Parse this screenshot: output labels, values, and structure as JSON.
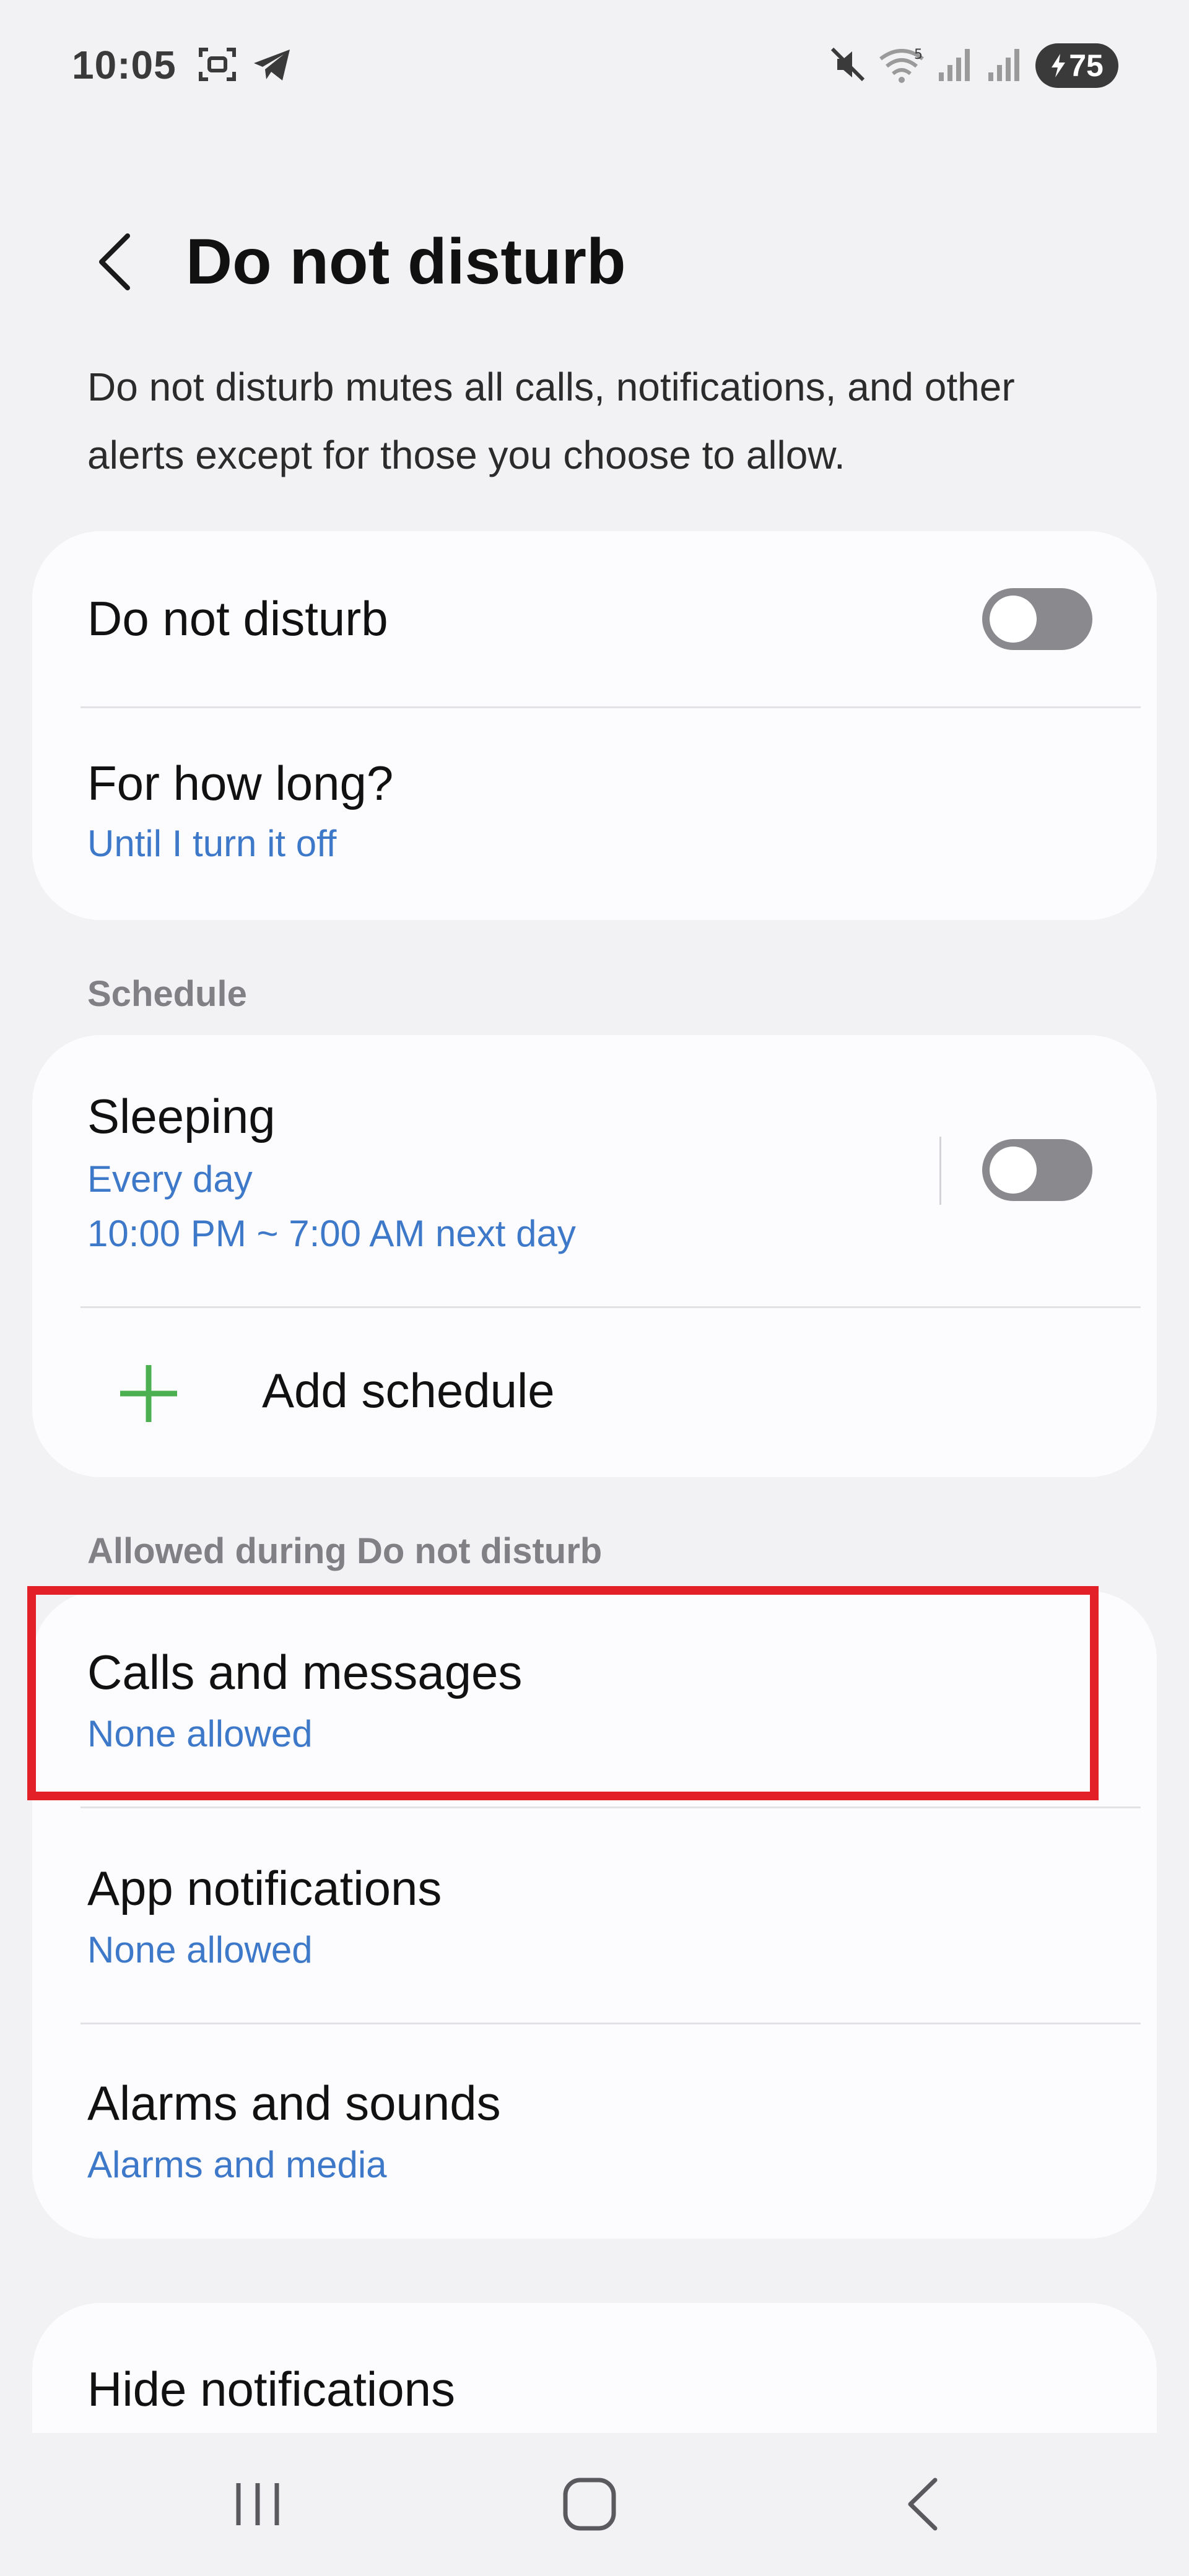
{
  "status_bar": {
    "time": "10:05",
    "battery_level": "75",
    "signal_badge": "5"
  },
  "header": {
    "title": "Do not disturb"
  },
  "description": "Do not disturb mutes all calls, notifications, and other alerts except for those you choose to allow.",
  "main_card": {
    "dnd_toggle": {
      "label": "Do not disturb",
      "state": "off"
    },
    "duration": {
      "label": "For how long?",
      "value": "Until I turn it off"
    }
  },
  "schedule_section": {
    "label": "Schedule",
    "sleeping": {
      "title": "Sleeping",
      "days": "Every day",
      "time": "10:00 PM ~ 7:00 AM next day",
      "state": "off"
    },
    "add_schedule_label": "Add schedule"
  },
  "allowed_section": {
    "label": "Allowed during Do not disturb",
    "items": [
      {
        "title": "Calls and messages",
        "value": "None allowed"
      },
      {
        "title": "App notifications",
        "value": "None allowed"
      },
      {
        "title": "Alarms and sounds",
        "value": "Alarms and media"
      }
    ]
  },
  "hide_notifications": {
    "title": "Hide notifications"
  },
  "colors": {
    "accent": "#3d78c9",
    "highlight": "#e32028",
    "add_icon": "#4caf50",
    "toggle_off": "#8a8a8e",
    "background": "#f2f2f4",
    "card": "#fcfcfe"
  },
  "icons": {
    "back": "chevron-left-icon",
    "add": "plus-icon",
    "nav_recents": "recents-icon",
    "nav_home": "home-icon",
    "nav_back": "back-icon",
    "status": [
      "screenshot-icon",
      "telegram-icon",
      "mute-icon",
      "wifi-icon",
      "signal-icon",
      "battery-icon"
    ]
  }
}
